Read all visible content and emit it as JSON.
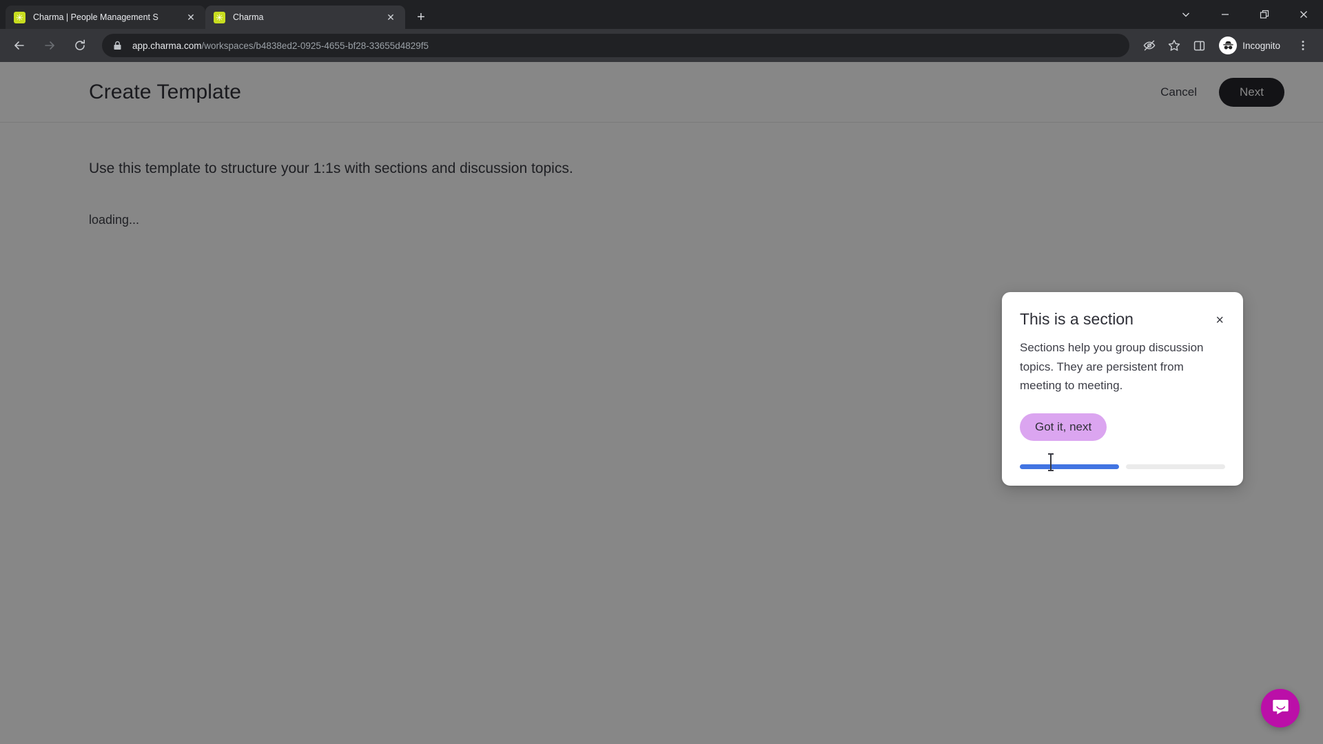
{
  "browser": {
    "tabs": [
      {
        "title": "Charma | People Management S",
        "favicon": "charma-star-icon",
        "active": false
      },
      {
        "title": "Charma",
        "favicon": "charma-star-icon",
        "active": true
      }
    ],
    "newtab_label": "+",
    "window_controls": {
      "tab_search": "tab-search-chevron",
      "minimize": "minimize",
      "maximize": "maximize",
      "close": "close"
    },
    "nav": {
      "back": "back-arrow",
      "forward": "forward-arrow",
      "reload": "reload"
    },
    "omnibox": {
      "lock": "site-info-lock",
      "url_domain": "app.charma.com",
      "url_path": "/workspaces/b4838ed2-0925-4655-bf28-33655d4829f5",
      "url_full": "app.charma.com/workspaces/b4838ed2-0925-4655-bf28-33655d4829f5"
    },
    "toolbar_icons": [
      "eye-off-icon",
      "bookmark-star-icon",
      "side-panel-icon"
    ],
    "profile": {
      "label": "Incognito",
      "avatar": "incognito-hat-icon"
    },
    "menu": "three-dot-menu-icon"
  },
  "page": {
    "title": "Create Template",
    "cancel_label": "Cancel",
    "next_label": "Next",
    "description": "Use this template to structure your 1:1s with sections and discussion topics.",
    "loading_label": "loading..."
  },
  "popover": {
    "title": "This is a section",
    "close_label": "×",
    "body": "Sections help you group discussion topics. They are persistent from meeting to meeting.",
    "cta_label": "Got it, next",
    "progress": {
      "total": 2,
      "completed": 1
    }
  },
  "widgets": {
    "intercom_launcher": "chat-bubble-icon"
  },
  "colors": {
    "tab_active": "#35363a",
    "tab_inactive": "#2b2c2f",
    "chrome_bg": "#202124",
    "favicon_green": "#c8dd1f",
    "next_button": "#24242b",
    "cta_lavender": "#dba5f0",
    "progress_blue": "#4274e2",
    "progress_track": "#ebebeb",
    "intercom_magenta": "#bb0fa8",
    "backdrop": "rgba(0,0,0,0.47)"
  }
}
